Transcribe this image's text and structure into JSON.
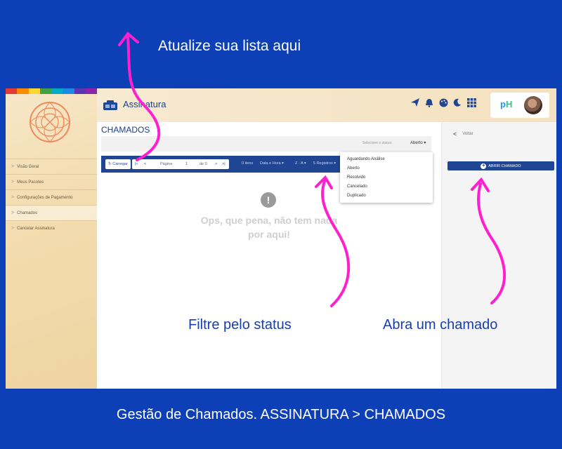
{
  "captions": {
    "top": "Atualize sua lista aqui",
    "bottom": "Gestão de Chamados. ASSINATURA > CHAMADOS",
    "filter": "Filtre pelo status",
    "open": "Abra um chamado"
  },
  "header": {
    "app_title": "Assinatura",
    "brand_text": "pH"
  },
  "sidebar": {
    "rainbow": [
      "#e53935",
      "#fb8c00",
      "#fdd835",
      "#43a047",
      "#00acc1",
      "#1e88e5",
      "#5e35b1",
      "#8e24aa"
    ],
    "items": [
      {
        "label": "Visão Geral"
      },
      {
        "label": "Meus Pacotes"
      },
      {
        "label": "Configurações de Pagamento"
      },
      {
        "label": "Chamados"
      },
      {
        "label": "Cancelar Assinatura"
      }
    ]
  },
  "main": {
    "title": "CHAMADOS",
    "status_label": "Selecione o status:",
    "status_value": "Aberto",
    "toolbar": {
      "loading": "Carregar",
      "page_label": "Página",
      "page_value": "1",
      "page_total": "de 0",
      "items_count": "0 itens",
      "sort_field": "Data e Hora",
      "sort_order": "Z - A",
      "per_page": "5 Registros"
    },
    "status_options": [
      "Aguardando Análise",
      "Aberto",
      "Resolvido",
      "Cancelado",
      "Duplicado"
    ],
    "empty_line1": "Ops, que pena, não tem nada",
    "empty_line2": "por aqui!"
  },
  "right": {
    "back_label": "Voltar",
    "open_button": "ABRIR CHAMADO"
  },
  "colors": {
    "background": "#0d3fb6",
    "primary": "#1f4593",
    "annotation": "#ff1fcf"
  }
}
